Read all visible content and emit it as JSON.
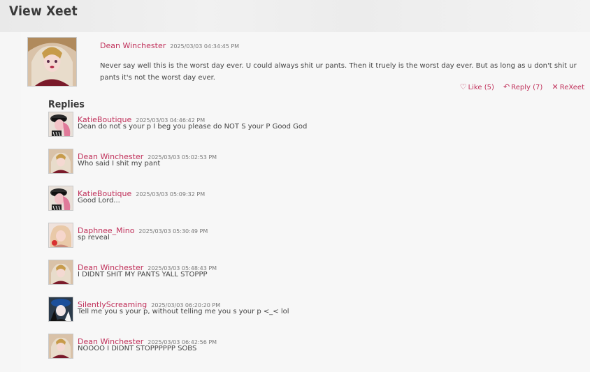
{
  "page": {
    "title": "View Xeet"
  },
  "xeet": {
    "author": "Dean Winchester",
    "timestamp": "2025/03/03 04:34:45 PM",
    "text": "Never say well this is the worst day ever. U could always shit ur pants. Then it truely is the worst day ever. But as long as u don't shit ur pants it's not the worst day ever.",
    "like_label": "Like (5)",
    "reply_label": "Reply (7)",
    "rexeet_label": "ReXeet"
  },
  "replies_title": "Replies",
  "replies": [
    {
      "author": "KatieBoutique",
      "timestamp": "2025/03/03 04:46:42 PM",
      "text": "Dean do not s your p I beg you please do NOT S your P Good God"
    },
    {
      "author": "Dean Winchester",
      "timestamp": "2025/03/03 05:02:53 PM",
      "text": "Who said I shit my pant"
    },
    {
      "author": "KatieBoutique",
      "timestamp": "2025/03/03 05:09:32 PM",
      "text": "Good Lord..."
    },
    {
      "author": "Daphnee_Mino",
      "timestamp": "2025/03/03 05:30:49 PM",
      "text": "sp reveal"
    },
    {
      "author": "Dean Winchester",
      "timestamp": "2025/03/03 05:48:43 PM",
      "text": "I DIDNT SHIT MY PANTS YALL STOPPP"
    },
    {
      "author": "SilentlyScreaming",
      "timestamp": "2025/03/03 06:20:20 PM",
      "text": "Tell me you s your p, without telling me you s your p <_< lol"
    },
    {
      "author": "Dean Winchester",
      "timestamp": "2025/03/03 06:42:56 PM",
      "text": "NOOOO I DIDNT STOPPPPPP SOBS"
    }
  ],
  "colors": {
    "username": "#c0305a",
    "background": "#f6f6f6"
  }
}
